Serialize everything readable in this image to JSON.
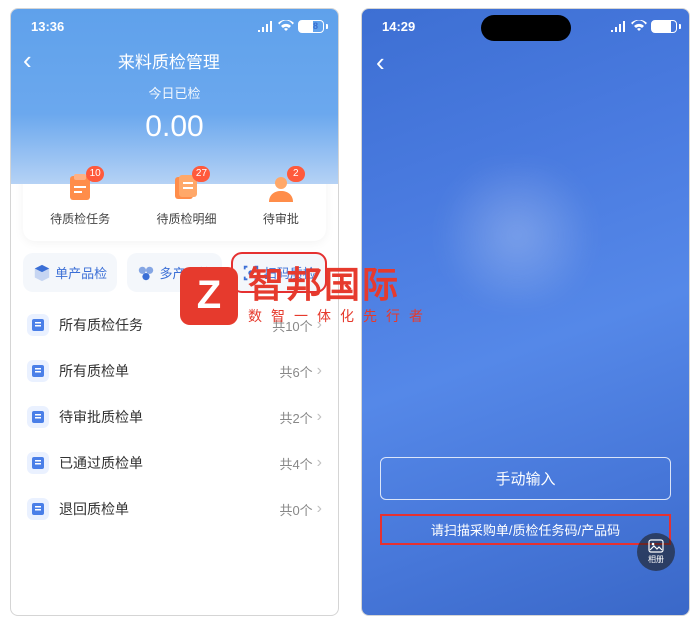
{
  "phone1": {
    "time": "13:36",
    "battery": "58",
    "page_title": "来料质检管理",
    "sub_title": "今日已检",
    "big_number": "0.00",
    "tiles": [
      {
        "label": "待质检任务",
        "badge": "10"
      },
      {
        "label": "待质检明细",
        "badge": "27"
      },
      {
        "label": "待审批",
        "badge": "2"
      }
    ],
    "actions": [
      {
        "label": "单产品检"
      },
      {
        "label": "多产品检"
      },
      {
        "label": "扫码质检"
      }
    ],
    "menu": [
      {
        "label": "所有质检任务",
        "count": "共10个"
      },
      {
        "label": "所有质检单",
        "count": "共6个"
      },
      {
        "label": "待审批质检单",
        "count": "共2个"
      },
      {
        "label": "已通过质检单",
        "count": "共4个"
      },
      {
        "label": "退回质检单",
        "count": "共0个"
      }
    ]
  },
  "phone2": {
    "time": "14:29",
    "battery": "79",
    "manual_label": "手动输入",
    "scan_hint": "请扫描采购单/质检任务码/产品码",
    "album_label": "相册"
  },
  "watermark": {
    "logo": "Z",
    "main": "智邦国际",
    "sub": "数智一体化先行者"
  }
}
